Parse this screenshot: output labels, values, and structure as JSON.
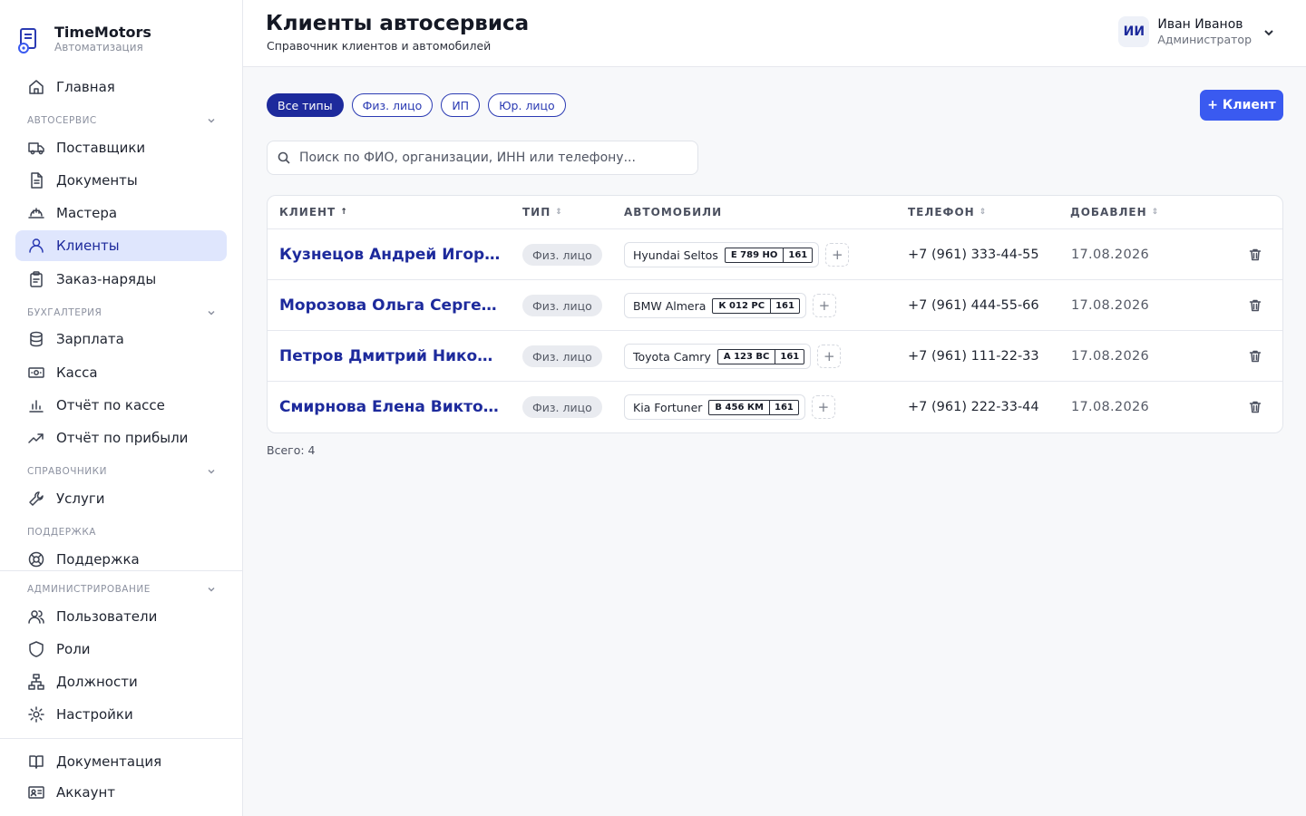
{
  "brand": {
    "title": "TimeMotors",
    "subtitle": "Автоматизация"
  },
  "nav": {
    "home": "Главная",
    "section_autoservice": "АВТОСЕРВИС",
    "suppliers": "Поставщики",
    "documents": "Документы",
    "masters": "Мастера",
    "clients": "Клиенты",
    "orders": "Заказ-наряды",
    "section_accounting": "БУХГАЛТЕРИЯ",
    "salary": "Зарплата",
    "cash": "Касса",
    "cash_report": "Отчёт по кассе",
    "profit_report": "Отчёт по прибыли",
    "section_references": "СПРАВОЧНИКИ",
    "services": "Услуги",
    "section_support": "ПОДДЕРЖКА",
    "support": "Поддержка",
    "section_admin": "АДМИНИСТРИРОВАНИЕ",
    "users": "Пользователи",
    "roles": "Роли",
    "positions": "Должности",
    "settings": "Настройки",
    "docs": "Документация",
    "account": "Аккаунт"
  },
  "header": {
    "title": "Клиенты автосервиса",
    "subtitle": "Справочник клиентов и автомобилей"
  },
  "user": {
    "initials": "ИИ",
    "name": "Иван Иванов",
    "role": "Администратор"
  },
  "filters": [
    "Все типы",
    "Физ. лицо",
    "ИП",
    "Юр. лицо"
  ],
  "add_button": "+ Клиент",
  "search": {
    "placeholder": "Поиск по ФИО, организации, ИНН или телефону...",
    "value": ""
  },
  "table": {
    "columns": {
      "client": "КЛИЕНТ",
      "type": "ТИП",
      "cars": "АВТОМОБИЛИ",
      "phone": "ТЕЛЕФОН",
      "added": "ДОБАВЛЕН"
    },
    "rows": [
      {
        "name": "Кузнецов Андрей Игоревич",
        "type": "Физ. лицо",
        "car": "Hyundai Seltos",
        "plate": "Е 789 НО",
        "region": "161",
        "phone": "+7 (961) 333-44-55",
        "date": "17.08.2026"
      },
      {
        "name": "Морозова Ольга Сергеевна",
        "type": "Физ. лицо",
        "car": "BMW Almera",
        "plate": "К 012 РС",
        "region": "161",
        "phone": "+7 (961) 444-55-66",
        "date": "17.08.2026"
      },
      {
        "name": "Петров Дмитрий Николаевич",
        "type": "Физ. лицо",
        "car": "Toyota Camry",
        "plate": "А 123 ВС",
        "region": "161",
        "phone": "+7 (961) 111-22-33",
        "date": "17.08.2026"
      },
      {
        "name": "Смирнова Елена Викторовна",
        "type": "Физ. лицо",
        "car": "Kia Fortuner",
        "plate": "В 456 КМ",
        "region": "161",
        "phone": "+7 (961) 222-33-44",
        "date": "17.08.2026"
      }
    ]
  },
  "total": "Всего: 4"
}
